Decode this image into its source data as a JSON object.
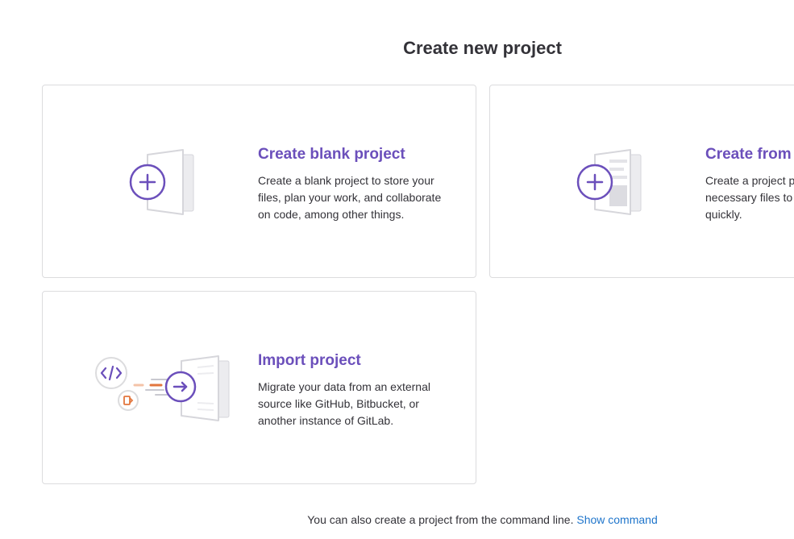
{
  "page": {
    "title": "Create new project"
  },
  "cards": {
    "blank": {
      "title": "Create blank project",
      "description": "Create a blank project to store your files, plan your work, and collaborate on code, among other things.",
      "icon": "plus-document-icon"
    },
    "template": {
      "title": "Create from template",
      "description": "Create a project pre-populated with the necessary files to get you started quickly.",
      "icon": "template-document-icon"
    },
    "import": {
      "title": "Import project",
      "description": "Migrate your data from an external source like GitHub, Bitbucket, or another instance of GitLab.",
      "icon": "import-arrow-icon"
    }
  },
  "footer": {
    "note": "You can also create a project from the command line.",
    "link_label": "Show command"
  },
  "colors": {
    "accent": "#6b4fbb",
    "link": "#1f75cb",
    "orange": "#e2763d",
    "border": "#dcdcde"
  }
}
